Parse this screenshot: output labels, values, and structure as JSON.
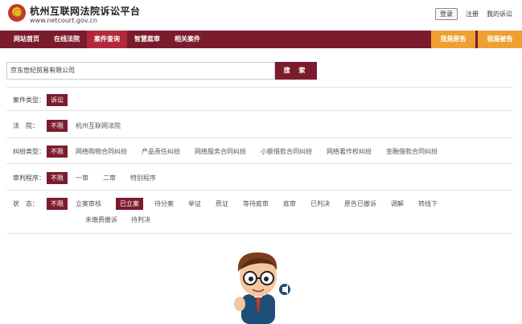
{
  "header": {
    "title": "杭州互联网法院诉讼平台",
    "url": "www.netcourt.gov.cn",
    "links": {
      "login": "登录",
      "register": "注册",
      "my_litigation": "我的诉讼"
    }
  },
  "nav": {
    "items": [
      "网站首页",
      "在线法院",
      "案件查询",
      "智慧庭审",
      "相关案件"
    ],
    "active_index": 2,
    "right_buttons": [
      "我是原告",
      "我是被告"
    ],
    "colors": {
      "primary": "#7b1c2c",
      "active": "#b4283a",
      "orange": "#f0a030"
    }
  },
  "search": {
    "value": "京东世纪贸易有限公司",
    "button": "搜 索"
  },
  "filters": {
    "case_type": {
      "label": "案件类型：",
      "selected": "诉讼"
    },
    "court": {
      "label": "法　院：",
      "selected": "不限",
      "options": [
        "杭州互联网法院"
      ]
    },
    "dispute_type": {
      "label": "纠纷类型：",
      "selected": "不限",
      "options": [
        "网络购物合同纠纷",
        "产品责任纠纷",
        "网络服务合同纠纷",
        "小额借款合同纠纷",
        "网络著作权纠纷",
        "金融借款合同纠纷"
      ]
    },
    "procedure": {
      "label": "审判程序：",
      "selected": "不限",
      "options": [
        "一审",
        "二审",
        "特别程序"
      ]
    },
    "status": {
      "label": "状　态：",
      "selected": "不限",
      "options": [
        "立案审核",
        "已立案",
        "待分案",
        "举证",
        "质证",
        "等待庭审",
        "庭审",
        "已判决",
        "原告已撤诉",
        "调解",
        "转线下"
      ],
      "selected_option": "已立案",
      "options_row2": [
        "未缴费撤诉",
        "待判决"
      ]
    }
  }
}
